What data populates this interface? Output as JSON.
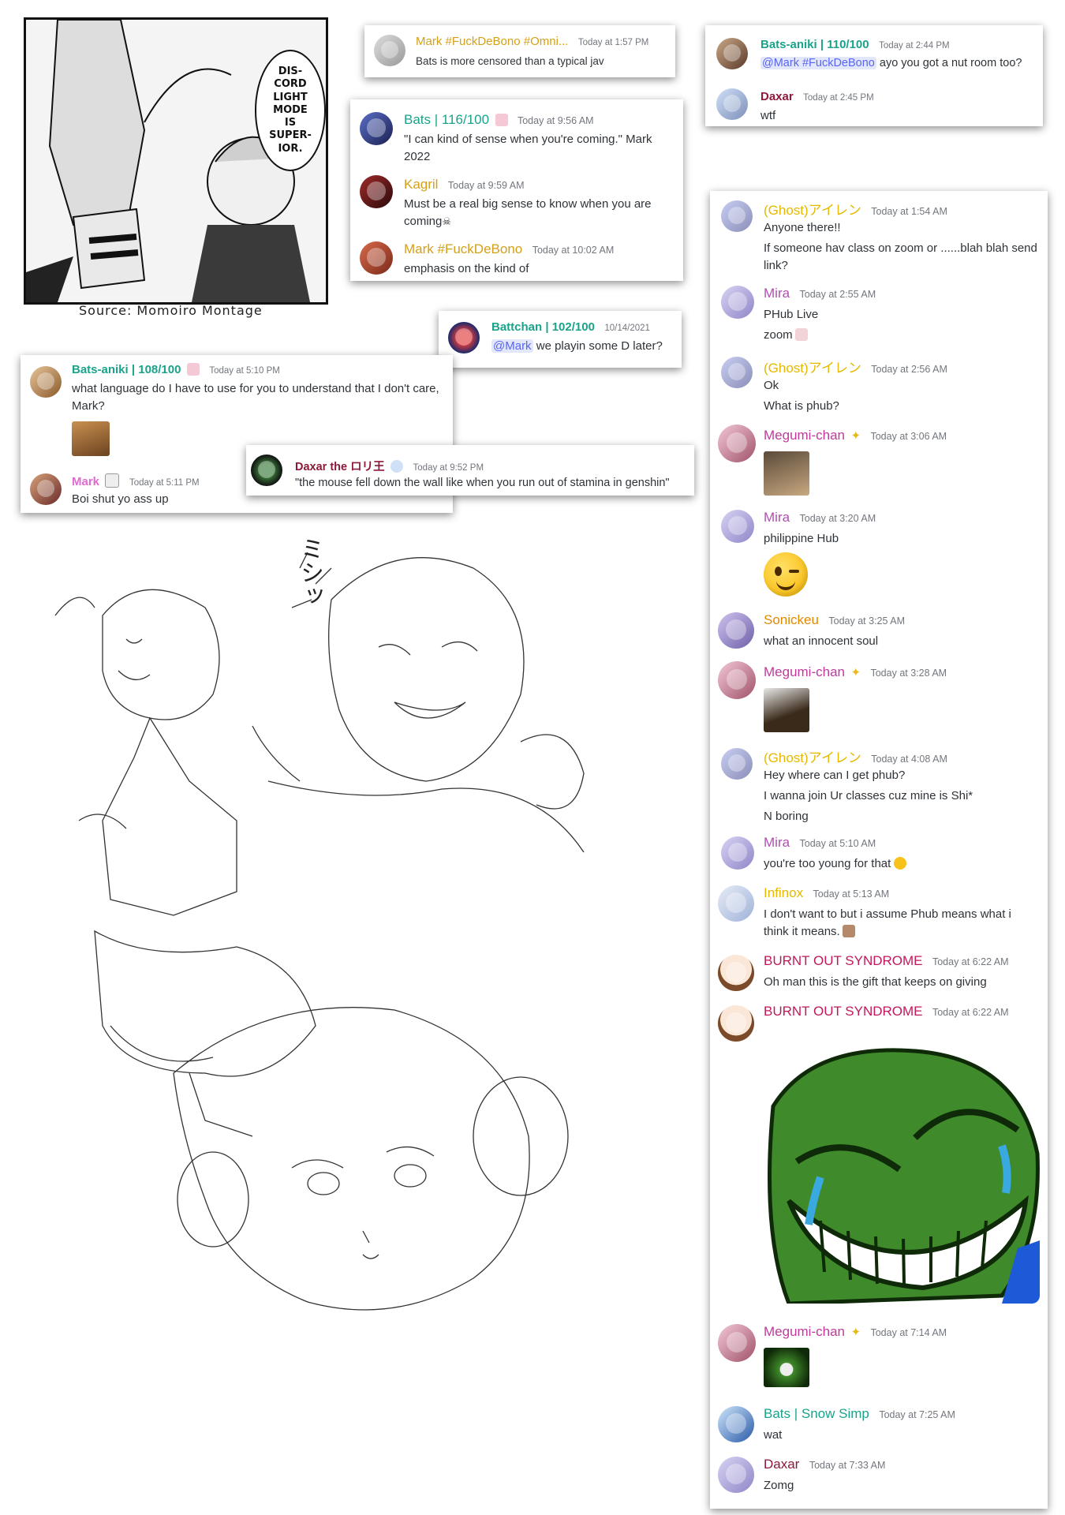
{
  "manga_panel": {
    "bubble_text": "DIS-\nCORD\nLIGHT\nMODE\nIS\nSUPER-\nIOR.",
    "caption": "Source: Momoiro Montage"
  },
  "colors": {
    "teal": "#1aa38a",
    "gold": "#d4a017",
    "magenta": "#c0399b",
    "purple": "#7b2d7b",
    "maroon": "#8b1a3a",
    "red_pink": "#c2185b",
    "orange": "#e08a00",
    "mira": "#b04fb0",
    "pink": "#e26ad2",
    "timestamp": "#72767d",
    "mention_bg": "#e3e7fb",
    "mention_fg": "#5865f2"
  },
  "card_a": {
    "user": "Mark #FuckDeBono #Omni...",
    "time": "Today at 1:57 PM",
    "text": "Bats is more censored than a typical jav"
  },
  "card_b": {
    "messages": [
      {
        "user": "Bats | 116/100",
        "time": "Today at 9:56 AM",
        "lines": [
          "\"I can kind of sense when you're coming.\" Mark",
          "2022"
        ]
      },
      {
        "user": "Kagril",
        "time": "Today at 9:59 AM",
        "lines": [
          "Must be a real big sense to know when you are",
          "coming"
        ]
      },
      {
        "user": "Mark #FuckDeBono",
        "time": "Today at 10:02 AM",
        "lines": [
          "emphasis on the kind of"
        ]
      }
    ]
  },
  "card_c": {
    "messages": [
      {
        "user": "Bats-aniki | 110/100",
        "time": "Today at 2:44 PM",
        "mention": "@Mark #FuckDeBono",
        "text": " ayo you got a nut room too?"
      },
      {
        "user": "Daxar",
        "time": "Today at 2:45 PM",
        "text": "wtf"
      }
    ]
  },
  "card_d": {
    "user": "Battchan | 102/100",
    "time": "10/14/2021",
    "mention": "@Mark",
    "text": " we playin some D later?"
  },
  "card_e": {
    "messages": [
      {
        "user": "Bats-aniki | 108/100",
        "time": "Today at 5:10 PM",
        "lines": [
          "what language do I have to use for you to understand that I don't care,",
          "Mark?"
        ]
      },
      {
        "user": "Mark",
        "time": "Today at 5:11 PM",
        "lines": [
          "Boi shut yo ass up"
        ]
      }
    ]
  },
  "card_f": {
    "user": "Daxar the ロリ王",
    "time": "Today at 9:52 PM",
    "text": "\"the mouse fell down the wall like when you run out of stamina in genshin\""
  },
  "sketch": {
    "sfx": "ミシッ"
  },
  "right_panel": {
    "messages": [
      {
        "user": "(Ghost)アイレン",
        "time": "Today at 1:54 AM",
        "lines": [
          "Anyone there!!",
          "If someone hav class on zoom or ......blah blah send",
          "link?"
        ]
      },
      {
        "user": "Mira",
        "time": "Today at 2:55 AM",
        "lines": [
          "PHub Live",
          "zoom"
        ]
      },
      {
        "user": "(Ghost)アイレン",
        "time": "Today at 2:56 AM",
        "lines": [
          "Ok",
          "What is phub?"
        ]
      },
      {
        "user": "Megumi-chan",
        "time": "Today at 3:06 AM",
        "lines": []
      },
      {
        "user": "Mira",
        "time": "Today at 3:20 AM",
        "lines": [
          "philippine Hub"
        ]
      },
      {
        "user": "Sonickeu",
        "time": "Today at 3:25 AM",
        "lines": [
          "what an innocent soul"
        ]
      },
      {
        "user": "Megumi-chan",
        "time": "Today at 3:28 AM",
        "lines": []
      },
      {
        "user": "(Ghost)アイレン",
        "time": "Today at 4:08 AM",
        "lines": [
          "Hey where can I get phub?",
          "I wanna join Ur classes cuz mine is Shi*",
          "N boring"
        ]
      },
      {
        "user": "Mira",
        "time": "Today at 5:10 AM",
        "lines": [
          "you're too young for that"
        ]
      },
      {
        "user": "Infinox",
        "time": "Today at 5:13 AM",
        "lines": [
          "I don't want to but i assume Phub means what i",
          "think it means."
        ]
      },
      {
        "user": "BURNT OUT SYNDROME",
        "time": "Today at 6:22 AM",
        "lines": [
          "Oh man this is the gift that keeps on giving"
        ]
      },
      {
        "user": "BURNT OUT SYNDROME",
        "time": "Today at 6:22 AM",
        "lines": []
      },
      {
        "user": "Megumi-chan",
        "time": "Today at 7:14 AM",
        "lines": []
      },
      {
        "user": "Bats | Snow Simp",
        "time": "Today at 7:25 AM",
        "lines": [
          "wat"
        ]
      },
      {
        "user": "Daxar",
        "time": "Today at 7:33 AM",
        "lines": [
          "Zomg"
        ]
      }
    ]
  }
}
